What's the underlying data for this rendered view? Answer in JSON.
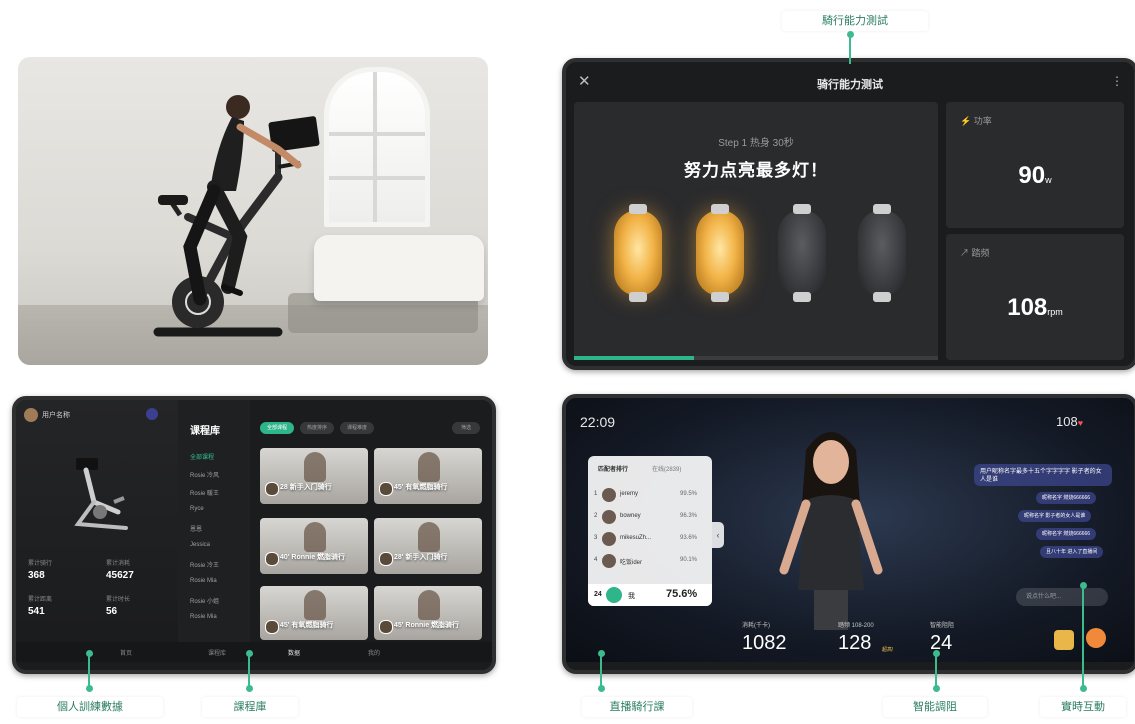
{
  "colors": {
    "accent": "#2fb58a",
    "callout_line": "#3dbb8e",
    "callout_text": "#2a7d62",
    "bulb_on": "#f2b347",
    "heart": "#ff4d5a"
  },
  "callouts": {
    "test": "騎行能力測試",
    "personal": "個人訓練數據",
    "library": "課程庫",
    "live": "直播騎行課",
    "resistance": "智能調阻",
    "interact": "實時互動"
  },
  "test_screen": {
    "title": "骑行能力测试",
    "close_icon": "close-icon",
    "more_icon": "kebab-icon",
    "step": "Step 1 热身 30秒",
    "headline": "努力点亮最多灯！",
    "bulbs": [
      {
        "state": "on"
      },
      {
        "state": "on"
      },
      {
        "state": "off"
      },
      {
        "state": "off"
      }
    ],
    "progress": 0.33,
    "power": {
      "icon": "bolt-icon",
      "label": "功率",
      "value": "90",
      "unit": "w"
    },
    "cadence": {
      "icon": "speed-icon",
      "label": "踏频",
      "value": "108",
      "unit": "rpm"
    }
  },
  "library_screen": {
    "user": "用户名称",
    "stats": [
      {
        "label": "累计骑行",
        "value": "368"
      },
      {
        "label": "累计消耗",
        "value": "45627"
      },
      {
        "label": "累计距离",
        "value": "541"
      },
      {
        "label": "累计时长",
        "value": "56"
      }
    ],
    "menu_title": "课程库",
    "menu_items": [
      "全部课程",
      "Rosie 冷风",
      "Rosie 暖王",
      "Ryce",
      "恩恩",
      "Jessica",
      "Rosie 冷王",
      "Rosie Mia",
      "Rosie 小姐",
      "Rosie Mia"
    ],
    "filters": [
      "全部课程",
      "热度排序",
      "课程难度"
    ],
    "filter_right": "筛选",
    "cards": [
      {
        "title": "28 新手入门骑行"
      },
      {
        "title": "45' 有氧燃脂骑行"
      },
      {
        "title": "40' Ronnie 燃脂骑行"
      },
      {
        "title": "28' 新手入门骑行"
      },
      {
        "title": "45' 有氧燃脂骑行"
      },
      {
        "title": "45' Ronnie 燃脂骑行"
      }
    ],
    "bottom_nav": [
      "首页",
      "课程库",
      "数据",
      "我的"
    ]
  },
  "live_screen": {
    "time": "22:09",
    "heart_rate": "108",
    "rank_tabs": [
      "匹配者排行",
      "在线(2839)"
    ],
    "ranking": [
      {
        "rank": "1",
        "name": "jeremy",
        "pct": "99.5%"
      },
      {
        "rank": "2",
        "name": "bowney",
        "pct": "96.3%"
      },
      {
        "rank": "3",
        "name": "mikesuZh...",
        "pct": "93.6%"
      },
      {
        "rank": "4",
        "name": "吃饭ider",
        "pct": "90.1%"
      }
    ],
    "me": {
      "rank": "24",
      "name": "我",
      "pct": "75.6%"
    },
    "chat_top": "用户昵称名字最多十五个字字字字 影子者的女人是谁",
    "chat": [
      "昵称名字 燃烧666666",
      "昵称名字 影子者的女人是谁",
      "昵称名字 燃烧666666",
      "且八十年 进入了直播间"
    ],
    "chat_placeholder": "说点什么吧...",
    "metrics": [
      {
        "label": "消耗(千卡)",
        "value": "1082"
      },
      {
        "label": "踏频 108-200",
        "value": "128",
        "tag": "超高!"
      },
      {
        "label": "智能阻阻",
        "value": "24"
      }
    ]
  }
}
